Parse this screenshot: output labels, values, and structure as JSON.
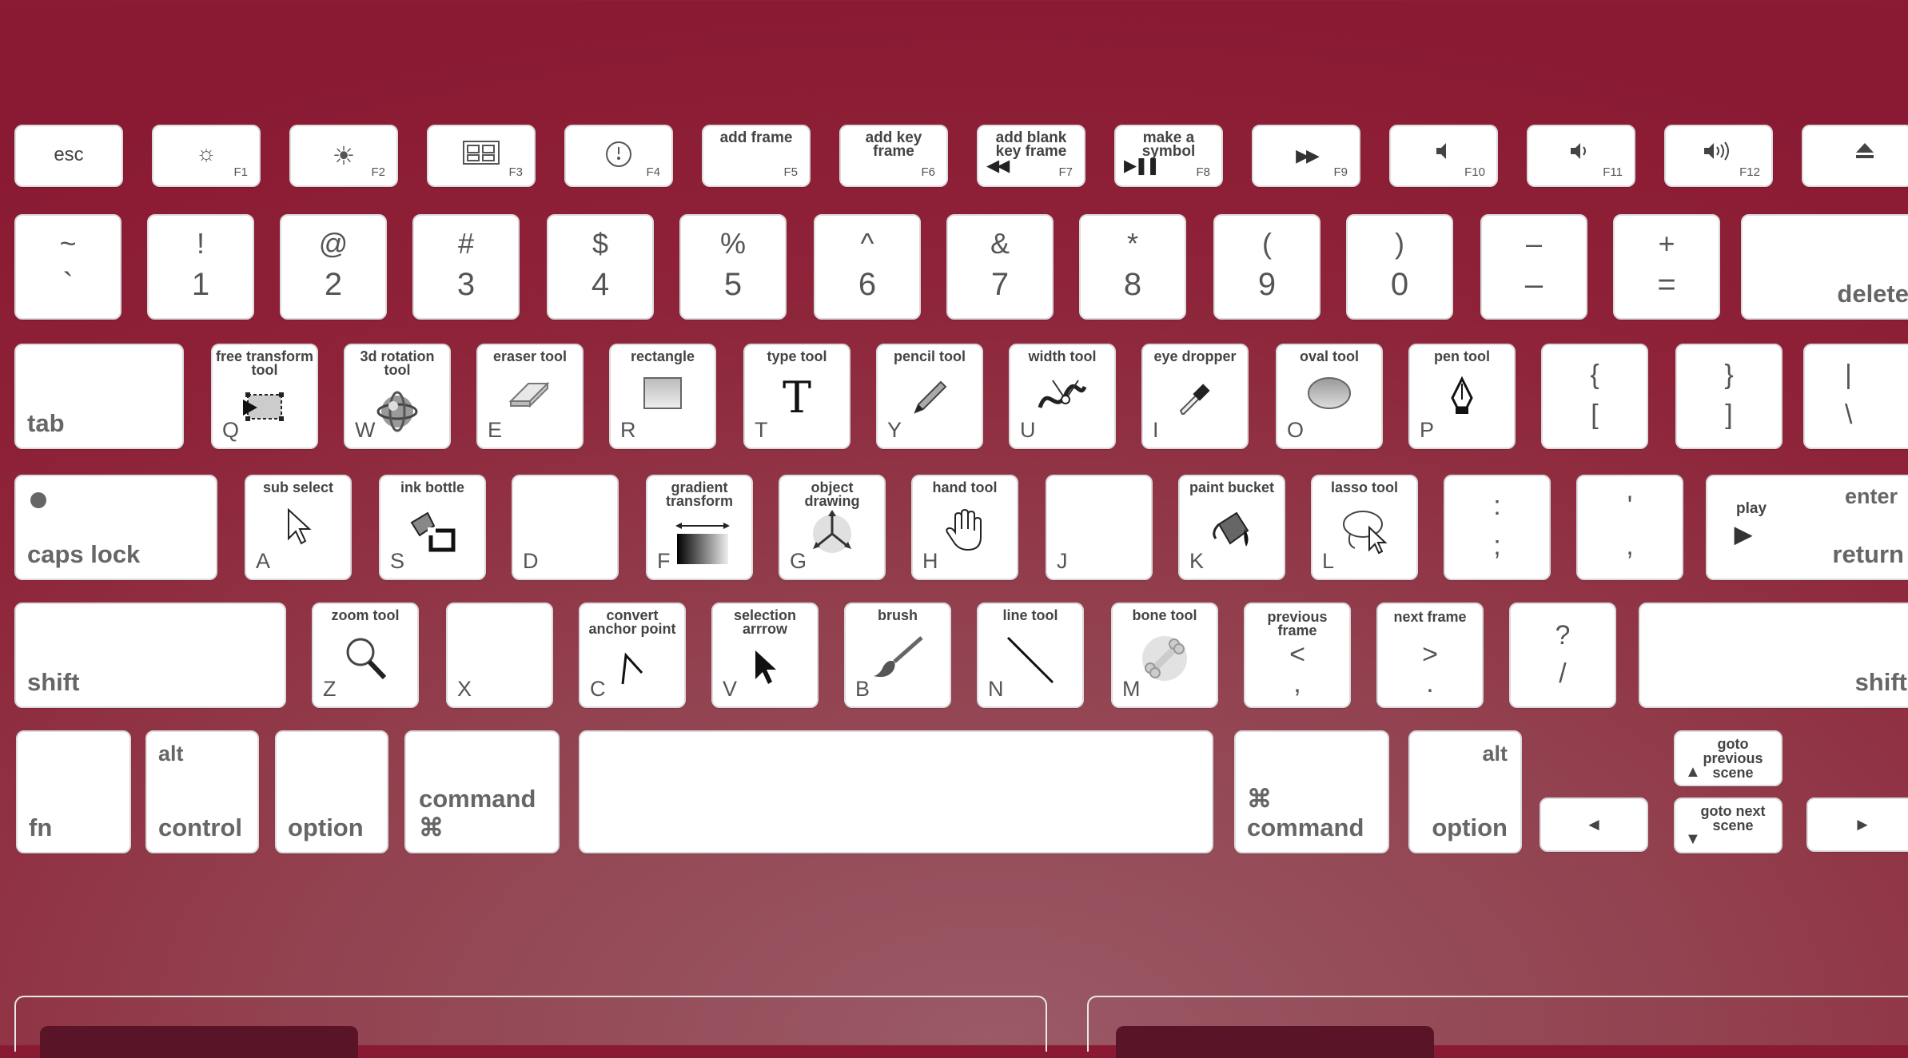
{
  "fkeys": {
    "esc": "esc",
    "f1": "F1",
    "f2": "F2",
    "f3": "F3",
    "f4": "F4",
    "f5_label": "add frame",
    "f5": "F5",
    "f6_label": "add key frame",
    "f6": "F6",
    "f7_label": "add blank key frame",
    "f7": "F7",
    "f8_label": "make a symbol",
    "f8": "F8",
    "f9": "F9",
    "f10": "F10",
    "f11": "F11",
    "f12": "F12"
  },
  "numrow": [
    {
      "top": "~",
      "bot": "`"
    },
    {
      "top": "!",
      "bot": "1"
    },
    {
      "top": "@",
      "bot": "2"
    },
    {
      "top": "#",
      "bot": "3"
    },
    {
      "top": "$",
      "bot": "4"
    },
    {
      "top": "%",
      "bot": "5"
    },
    {
      "top": "^",
      "bot": "6"
    },
    {
      "top": "&",
      "bot": "7"
    },
    {
      "top": "*",
      "bot": "8"
    },
    {
      "top": "(",
      "bot": "9"
    },
    {
      "top": ")",
      "bot": "0"
    },
    {
      "top": "–",
      "bot": "–"
    },
    {
      "top": "+",
      "bot": "="
    }
  ],
  "delete": "delete",
  "tab": "tab",
  "qrow": [
    {
      "tool": "free transform tool",
      "letter": "Q"
    },
    {
      "tool": "3d rotation tool",
      "letter": "W"
    },
    {
      "tool": "eraser tool",
      "letter": "E"
    },
    {
      "tool": "rectangle",
      "letter": "R"
    },
    {
      "tool": "type tool",
      "letter": "T"
    },
    {
      "tool": "pencil tool",
      "letter": "Y"
    },
    {
      "tool": "width tool",
      "letter": "U"
    },
    {
      "tool": "eye dropper",
      "letter": "I"
    },
    {
      "tool": "oval tool",
      "letter": "O"
    },
    {
      "tool": "pen tool",
      "letter": "P"
    }
  ],
  "brackets": [
    {
      "top": "{",
      "bot": "["
    },
    {
      "top": "}",
      "bot": "]"
    },
    {
      "top": "|",
      "bot": "\\"
    }
  ],
  "caps": "caps lock",
  "arow": [
    {
      "tool": "sub select",
      "letter": "A"
    },
    {
      "tool": "ink bottle",
      "letter": "S"
    },
    {
      "tool": "",
      "letter": "D"
    },
    {
      "tool": "gradient transform",
      "letter": "F"
    },
    {
      "tool": "object drawing",
      "letter": "G"
    },
    {
      "tool": "hand tool",
      "letter": "H"
    },
    {
      "tool": "",
      "letter": "J"
    },
    {
      "tool": "paint bucket",
      "letter": "K"
    },
    {
      "tool": "lasso tool",
      "letter": "L"
    }
  ],
  "semis": [
    {
      "top": ":",
      "bot": ";"
    },
    {
      "top": "'",
      "bot": ","
    }
  ],
  "enter": {
    "top": "enter",
    "bottom": "return",
    "play": "play"
  },
  "shift": "shift",
  "zrow": [
    {
      "tool": "zoom tool",
      "letter": "Z"
    },
    {
      "tool": "",
      "letter": "X"
    },
    {
      "tool": "convert anchor point",
      "letter": "C"
    },
    {
      "tool": "selection arrrow",
      "letter": "V"
    },
    {
      "tool": "brush",
      "letter": "B"
    },
    {
      "tool": "line tool",
      "letter": "N"
    },
    {
      "tool": "bone tool",
      "letter": "M"
    }
  ],
  "frames": [
    {
      "label": "previous frame",
      "top": "<",
      "bot": ","
    },
    {
      "label": "next frame",
      "top": ">",
      "bot": "."
    },
    {
      "label": "",
      "top": "?",
      "bot": "/"
    }
  ],
  "bottom": {
    "fn": "fn",
    "alt": "alt",
    "control": "control",
    "option": "option",
    "command_left": "command ⌘",
    "command_right": "⌘ command",
    "goto_prev": "goto previous scene",
    "goto_next": "goto next scene",
    "left_arrow": "◄",
    "right_arrow": "►",
    "up_arrow": "▲",
    "down_arrow": "▼"
  }
}
